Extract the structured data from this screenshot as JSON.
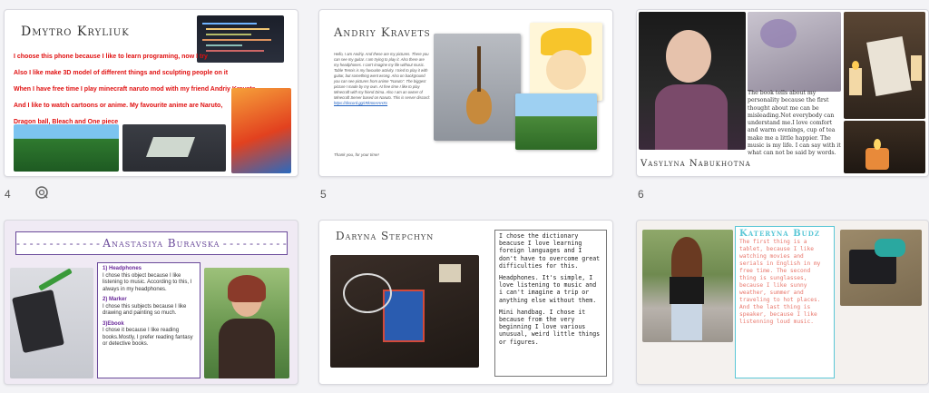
{
  "slide_numbers": {
    "row2_col1": "4",
    "row2_col2": "5",
    "row2_col3": "6"
  },
  "s1": {
    "title": "Dmytro Kryliuk",
    "lines": [
      "I choose this phone because I like to learn programing, now I try",
      "Also I like make 3D model of different things and sculpting people on it",
      "When I have free time I play minecraft naruto mod with my friend Andriy Kravets",
      "And I like to watch cartoons or anime. My favourite anime are Naruto,",
      "Dragon ball, Bleach and One piece"
    ]
  },
  "s2": {
    "title": "Andriy Kravets",
    "body": "Hello, I am Andriy. And these are my pictures. There you can see my guitar. I am trying to play it. Also there are my headphones. I can't imagine my life without music. Table Tennis is my favourite activity. I tried to play it with guitar, but something went wrong. Also on background you can see pictures from anime \"Naruto\". The biggest picture I made by my own. At free time I like to play Minecraft with my friend Dima. Also I am an owner of Minecraft Server based on Naruto. This is server discord:",
    "link": "https://discord.gg/rRkmnHAHXs",
    "thanks": "Thank you, for your time!"
  },
  "s3": {
    "name": "Vasylyna Nabukhotna",
    "body": "The book tells about my personality because the first thought about me can be misleading.Not everybody can understand me.I love comfort and warm evenings, cup of tea make me a little happier. The music is my life. I can say with it what can not be said by words."
  },
  "s4": {
    "title": "Anastasiya Buravska",
    "items": [
      {
        "heading": "1) Headphones",
        "text": "I chose this object because I like listening to music. According to this, I always in my headphones."
      },
      {
        "heading": "2) Marker",
        "text": "I chose this subjects because I like drawing and painting so much."
      },
      {
        "heading": "3)Ebook",
        "text": "I chose it because I like reading books.Mostly, I prefer reading fantasy or detective books."
      }
    ]
  },
  "s5": {
    "title": "Daryna Stepchyn",
    "p1": "I chose the dictionary beacuse I love learning foreign languages and I don't have to overcome great difficulties for this.",
    "p2": "Headphones. It's simple, I love listening to music and i can't imagine a trip or anything else without them.",
    "p3": "Mini handbag. I chose it because from the very beginning I love various unusual, weird little things or figures."
  },
  "s6": {
    "title": "Kateryna Budz",
    "body": "The first thing is a tablet, because I like watching movies and serials in English in my free time. The second thing is sunglasses, because I like sunny weather, summer and traveling to hot places. And the last thing is speaker, because I like listenning loud music."
  },
  "colors": {
    "red": "#e01010",
    "cyan": "#5bc7d6",
    "salmon": "#e8776c",
    "purple": "#6a4a9a"
  }
}
